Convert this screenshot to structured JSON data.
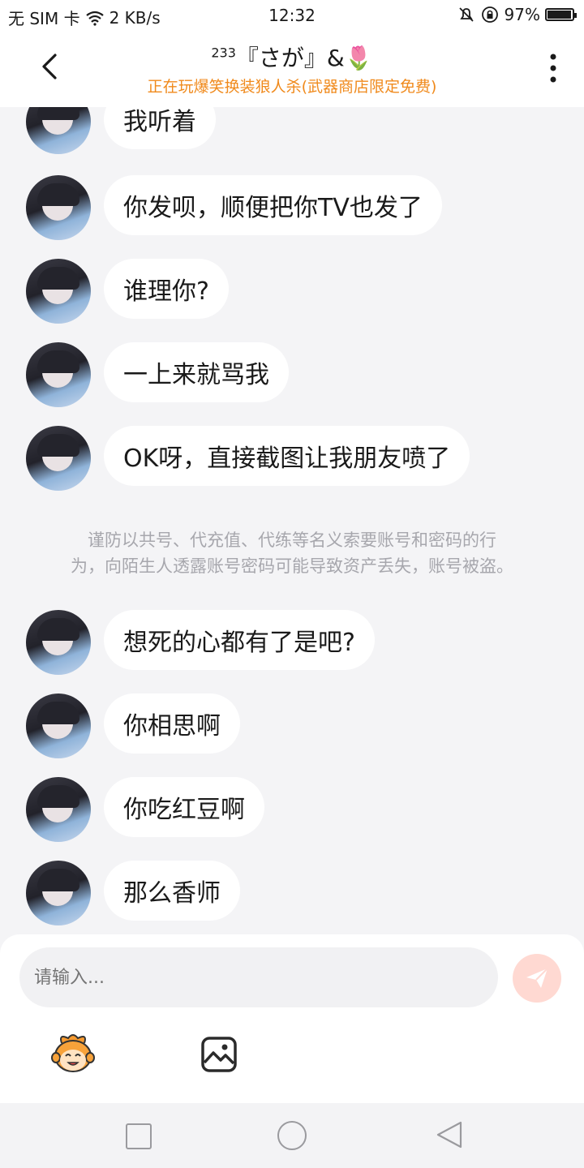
{
  "status_bar": {
    "carrier": "无 SIM 卡",
    "speed": "2 KB/s",
    "time": "12:32",
    "battery": "97%",
    "battery_level": 0.97
  },
  "header": {
    "title_prefix": "233",
    "title_main": "『さが』&🌷",
    "subtitle": "正在玩爆笑换装狼人杀(武器商店限定免费)"
  },
  "messages_before": [
    {
      "text": "我听着"
    },
    {
      "text": "你发呗，顺便把你TV也发了"
    },
    {
      "text": "谁理你?"
    },
    {
      "text": "一上来就骂我"
    },
    {
      "text": "OK呀，直接截图让我朋友喷了"
    }
  ],
  "notice": {
    "line1": "谨防以共号、代充值、代练等名义索要账号和密码的行",
    "line2": "为，向陌生人透露账号密码可能导致资产丢失，账号被盗。"
  },
  "messages_after": [
    {
      "text": "想死的心都有了是吧?"
    },
    {
      "text": "你相思啊"
    },
    {
      "text": "你吃红豆啊"
    },
    {
      "text": "那么香师"
    }
  ],
  "input": {
    "placeholder": "请输入..."
  },
  "icons": {
    "back": "chevron-left-icon",
    "more": "more-vertical-icon",
    "send": "send-icon",
    "emoji": "emoji-mascot-icon",
    "image": "image-icon"
  },
  "colors": {
    "accent_orange": "#f08a1c",
    "send_bg": "#ffd9d2",
    "send_icon": "#ffffff"
  }
}
